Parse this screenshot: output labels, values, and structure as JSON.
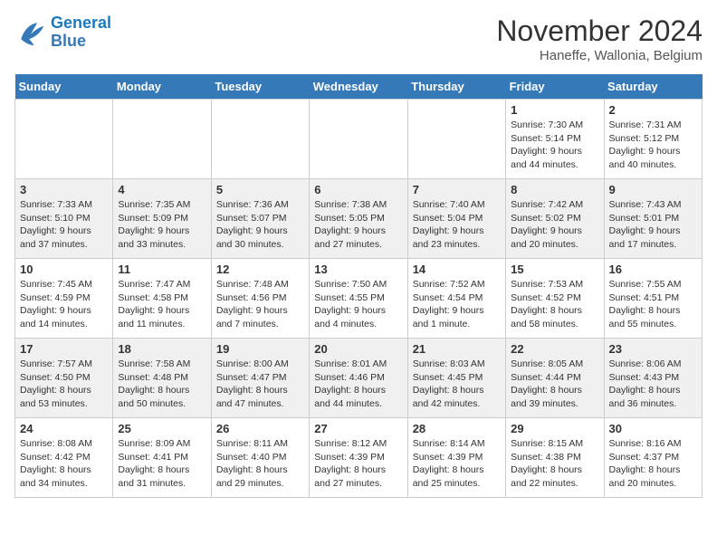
{
  "logo": {
    "text_general": "General",
    "text_blue": "Blue"
  },
  "header": {
    "month": "November 2024",
    "location": "Haneffe, Wallonia, Belgium"
  },
  "weekdays": [
    "Sunday",
    "Monday",
    "Tuesday",
    "Wednesday",
    "Thursday",
    "Friday",
    "Saturday"
  ],
  "weeks": [
    [
      {
        "day": "",
        "info": ""
      },
      {
        "day": "",
        "info": ""
      },
      {
        "day": "",
        "info": ""
      },
      {
        "day": "",
        "info": ""
      },
      {
        "day": "",
        "info": ""
      },
      {
        "day": "1",
        "info": "Sunrise: 7:30 AM\nSunset: 5:14 PM\nDaylight: 9 hours and 44 minutes."
      },
      {
        "day": "2",
        "info": "Sunrise: 7:31 AM\nSunset: 5:12 PM\nDaylight: 9 hours and 40 minutes."
      }
    ],
    [
      {
        "day": "3",
        "info": "Sunrise: 7:33 AM\nSunset: 5:10 PM\nDaylight: 9 hours and 37 minutes."
      },
      {
        "day": "4",
        "info": "Sunrise: 7:35 AM\nSunset: 5:09 PM\nDaylight: 9 hours and 33 minutes."
      },
      {
        "day": "5",
        "info": "Sunrise: 7:36 AM\nSunset: 5:07 PM\nDaylight: 9 hours and 30 minutes."
      },
      {
        "day": "6",
        "info": "Sunrise: 7:38 AM\nSunset: 5:05 PM\nDaylight: 9 hours and 27 minutes."
      },
      {
        "day": "7",
        "info": "Sunrise: 7:40 AM\nSunset: 5:04 PM\nDaylight: 9 hours and 23 minutes."
      },
      {
        "day": "8",
        "info": "Sunrise: 7:42 AM\nSunset: 5:02 PM\nDaylight: 9 hours and 20 minutes."
      },
      {
        "day": "9",
        "info": "Sunrise: 7:43 AM\nSunset: 5:01 PM\nDaylight: 9 hours and 17 minutes."
      }
    ],
    [
      {
        "day": "10",
        "info": "Sunrise: 7:45 AM\nSunset: 4:59 PM\nDaylight: 9 hours and 14 minutes."
      },
      {
        "day": "11",
        "info": "Sunrise: 7:47 AM\nSunset: 4:58 PM\nDaylight: 9 hours and 11 minutes."
      },
      {
        "day": "12",
        "info": "Sunrise: 7:48 AM\nSunset: 4:56 PM\nDaylight: 9 hours and 7 minutes."
      },
      {
        "day": "13",
        "info": "Sunrise: 7:50 AM\nSunset: 4:55 PM\nDaylight: 9 hours and 4 minutes."
      },
      {
        "day": "14",
        "info": "Sunrise: 7:52 AM\nSunset: 4:54 PM\nDaylight: 9 hours and 1 minute."
      },
      {
        "day": "15",
        "info": "Sunrise: 7:53 AM\nSunset: 4:52 PM\nDaylight: 8 hours and 58 minutes."
      },
      {
        "day": "16",
        "info": "Sunrise: 7:55 AM\nSunset: 4:51 PM\nDaylight: 8 hours and 55 minutes."
      }
    ],
    [
      {
        "day": "17",
        "info": "Sunrise: 7:57 AM\nSunset: 4:50 PM\nDaylight: 8 hours and 53 minutes."
      },
      {
        "day": "18",
        "info": "Sunrise: 7:58 AM\nSunset: 4:48 PM\nDaylight: 8 hours and 50 minutes."
      },
      {
        "day": "19",
        "info": "Sunrise: 8:00 AM\nSunset: 4:47 PM\nDaylight: 8 hours and 47 minutes."
      },
      {
        "day": "20",
        "info": "Sunrise: 8:01 AM\nSunset: 4:46 PM\nDaylight: 8 hours and 44 minutes."
      },
      {
        "day": "21",
        "info": "Sunrise: 8:03 AM\nSunset: 4:45 PM\nDaylight: 8 hours and 42 minutes."
      },
      {
        "day": "22",
        "info": "Sunrise: 8:05 AM\nSunset: 4:44 PM\nDaylight: 8 hours and 39 minutes."
      },
      {
        "day": "23",
        "info": "Sunrise: 8:06 AM\nSunset: 4:43 PM\nDaylight: 8 hours and 36 minutes."
      }
    ],
    [
      {
        "day": "24",
        "info": "Sunrise: 8:08 AM\nSunset: 4:42 PM\nDaylight: 8 hours and 34 minutes."
      },
      {
        "day": "25",
        "info": "Sunrise: 8:09 AM\nSunset: 4:41 PM\nDaylight: 8 hours and 31 minutes."
      },
      {
        "day": "26",
        "info": "Sunrise: 8:11 AM\nSunset: 4:40 PM\nDaylight: 8 hours and 29 minutes."
      },
      {
        "day": "27",
        "info": "Sunrise: 8:12 AM\nSunset: 4:39 PM\nDaylight: 8 hours and 27 minutes."
      },
      {
        "day": "28",
        "info": "Sunrise: 8:14 AM\nSunset: 4:39 PM\nDaylight: 8 hours and 25 minutes."
      },
      {
        "day": "29",
        "info": "Sunrise: 8:15 AM\nSunset: 4:38 PM\nDaylight: 8 hours and 22 minutes."
      },
      {
        "day": "30",
        "info": "Sunrise: 8:16 AM\nSunset: 4:37 PM\nDaylight: 8 hours and 20 minutes."
      }
    ]
  ]
}
